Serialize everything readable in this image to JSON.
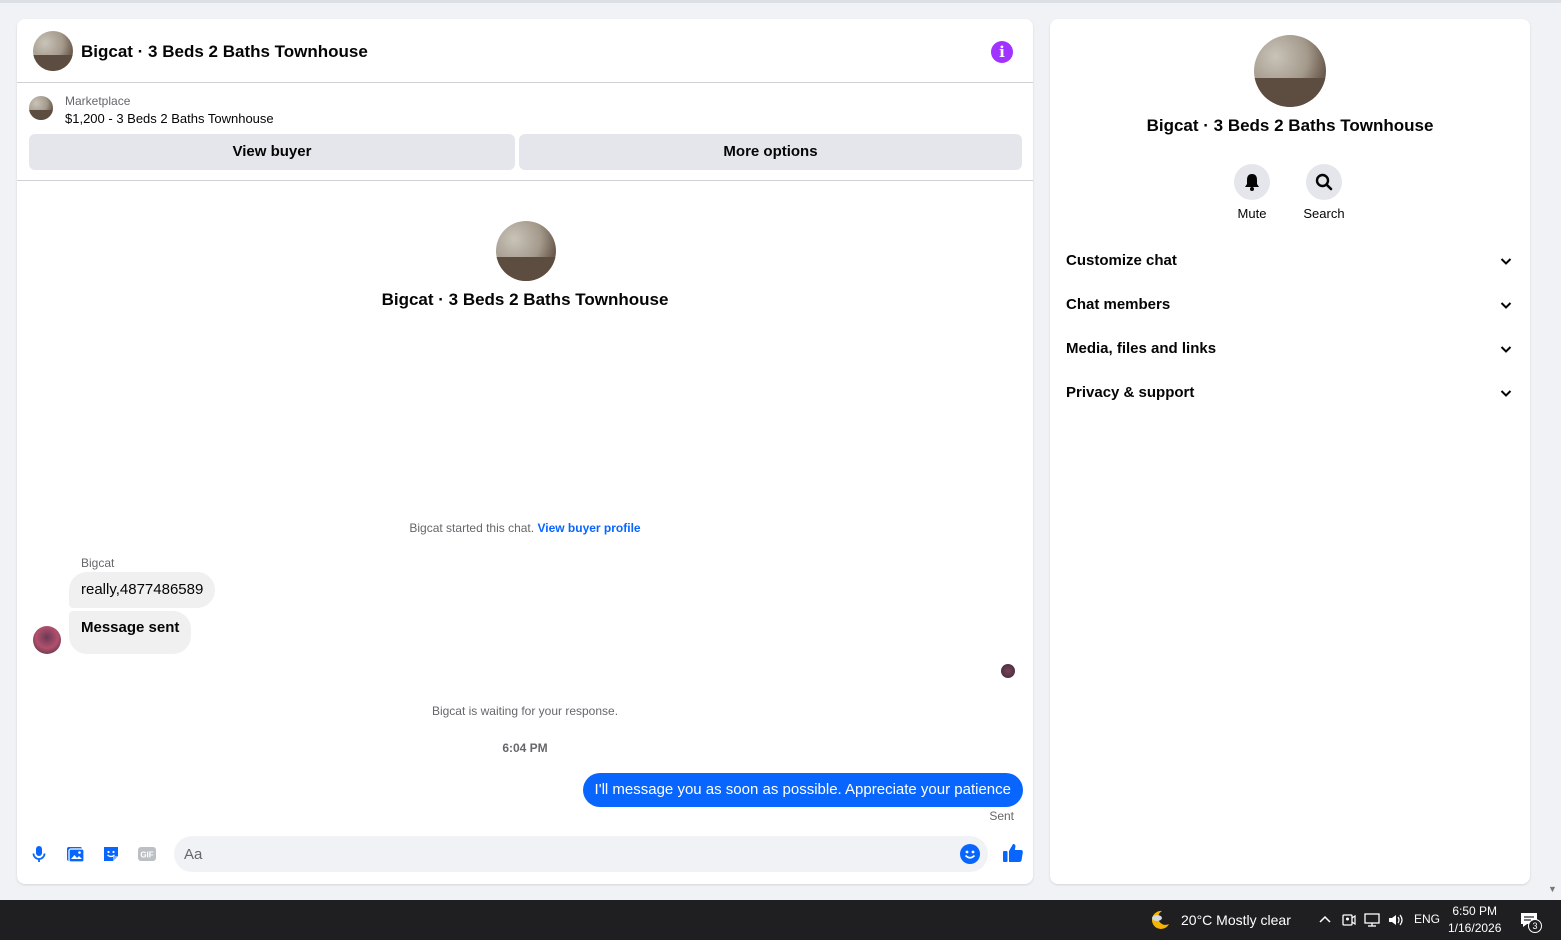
{
  "header": {
    "title": "Bigcat · 3 Beds 2 Baths Townhouse",
    "info_icon": "info-icon"
  },
  "marketplace": {
    "label": "Marketplace",
    "listing": "$1,200 - 3 Beds 2 Baths Townhouse"
  },
  "buttons": {
    "view_buyer": "View buyer",
    "more_options": "More options"
  },
  "conversation": {
    "title": "Bigcat · 3 Beds 2 Baths Townhouse",
    "started_text": "Bigcat started this chat.",
    "started_link": "View buyer profile",
    "sender_name": "Bigcat",
    "messages_in": [
      "really,4877486589",
      "Message sent"
    ],
    "waiting_text": "Bigcat is waiting for your response.",
    "timestamp": "6:04 PM",
    "message_out": "I'll message you as soon as possible. Appreciate your patience",
    "status": "Sent"
  },
  "composer": {
    "placeholder": "Aa",
    "icons": [
      "microphone-icon",
      "photo-icon",
      "sticker-icon",
      "gif-icon",
      "emoji-icon",
      "thumbs-up-icon"
    ]
  },
  "sidebar": {
    "title": "Bigcat · 3 Beds 2 Baths Townhouse",
    "actions": [
      {
        "label": "Mute",
        "icon": "bell-icon"
      },
      {
        "label": "Search",
        "icon": "search-icon"
      }
    ],
    "sections": [
      "Customize chat",
      "Chat members",
      "Media, files and links",
      "Privacy & support"
    ]
  },
  "taskbar": {
    "weather": "20°C  Mostly clear",
    "language": "ENG",
    "time": "6:50 PM",
    "date": "1/16/2026",
    "notification_count": "3"
  },
  "colors": {
    "accent": "#0866ff",
    "info": "#a033ff",
    "bubble_in": "#f0f0f0",
    "taskbar": "#1f1f22"
  }
}
